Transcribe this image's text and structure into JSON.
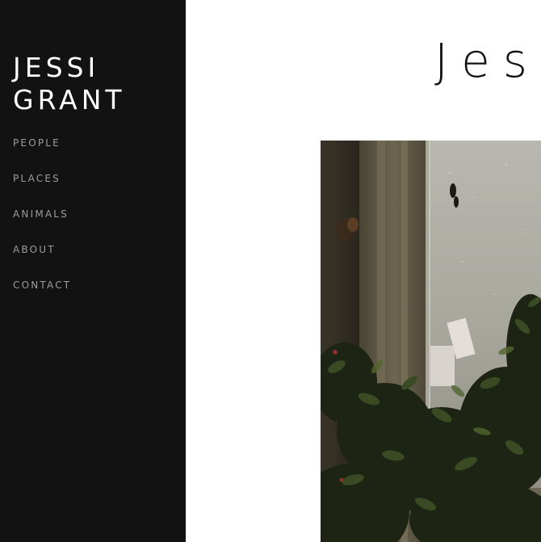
{
  "site": {
    "logo_line1": "JESSI",
    "logo_line2": "GRANT"
  },
  "nav": {
    "items": [
      {
        "label": "PEOPLE"
      },
      {
        "label": "PLACES"
      },
      {
        "label": "ANIMALS"
      },
      {
        "label": "ABOUT"
      },
      {
        "label": "CONTACT"
      }
    ]
  },
  "main": {
    "title": "Jessi Grant"
  },
  "colors": {
    "sidebar_bg": "#121212",
    "logo_text": "#ffffff",
    "nav_text": "#9c9c9c",
    "page_bg": "#ffffff"
  }
}
